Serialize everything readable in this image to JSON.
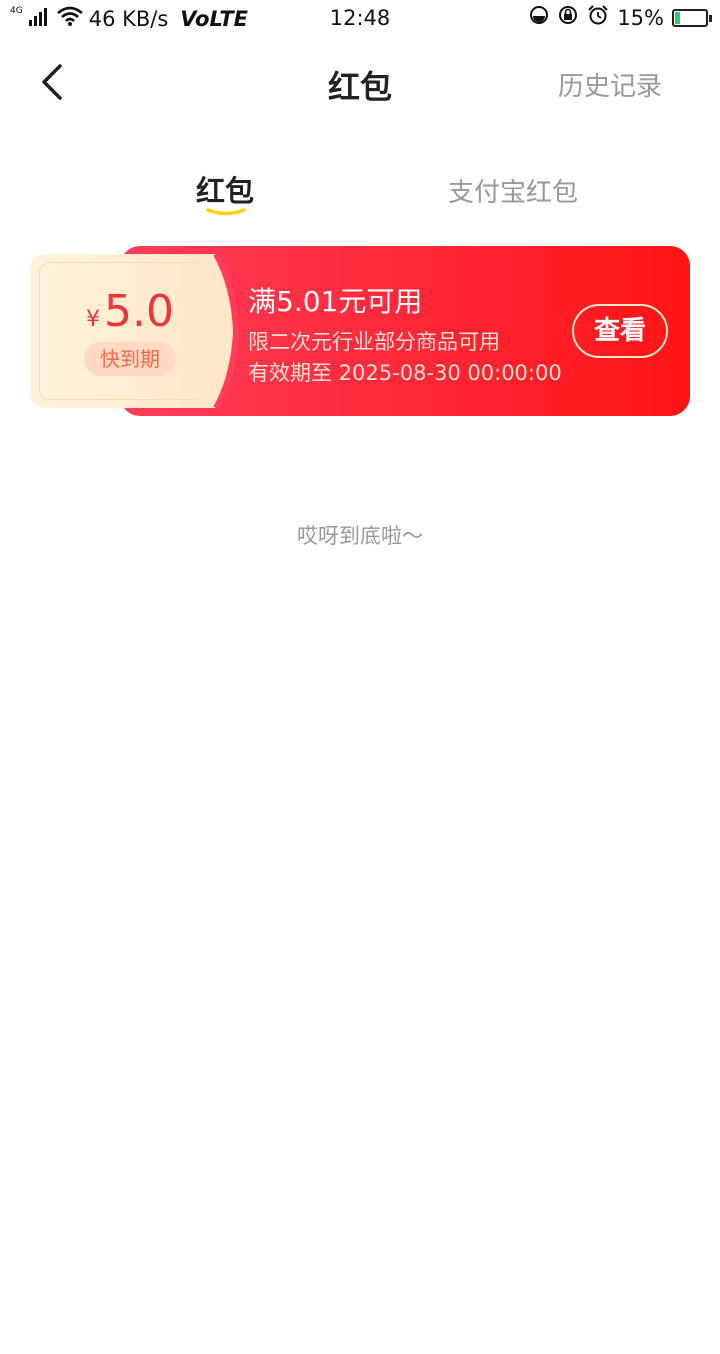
{
  "status_bar": {
    "network": "4G",
    "speed": "46 KB/s",
    "volte": "VoLTE",
    "time": "12:48",
    "battery": "15%",
    "battery_level": 0.15
  },
  "nav": {
    "title": "红包",
    "history_label": "历史记录"
  },
  "tabs": [
    {
      "label": "红包",
      "active": true
    },
    {
      "label": "支付宝红包",
      "active": false
    }
  ],
  "coupon": {
    "currency": "¥",
    "amount": "5.0",
    "badge": "快到期",
    "title": "满5.01元可用",
    "description": "限二次元行业部分商品可用",
    "validity": "有效期至 2025-08-30 00:00:00",
    "action_label": "查看"
  },
  "footer_text": "哎呀到底啦〜",
  "colors": {
    "accent_red": "#ff1414",
    "gradient_start": "#ff3d5a",
    "amount_red": "#f0343a",
    "tab_underline": "#ffd200"
  }
}
